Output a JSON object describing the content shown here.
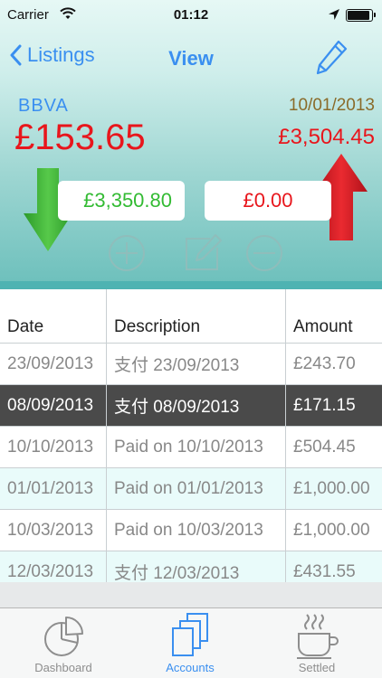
{
  "status_bar": {
    "carrier": "Carrier",
    "time": "01:12"
  },
  "nav": {
    "back_label": "Listings",
    "title": "View"
  },
  "account": {
    "name": "BBVA",
    "balance": "£153.65",
    "date": "10/01/2013",
    "total": "£3,504.45",
    "money_in": "£3,350.80",
    "money_out": "£0.00"
  },
  "table": {
    "headers": [
      "Date",
      "Description",
      "Amount"
    ],
    "rows": [
      {
        "date": "23/09/2013",
        "desc": "支付 23/09/2013",
        "amount": "£243.70"
      },
      {
        "date": "08/09/2013",
        "desc": "支付 08/09/2013",
        "amount": "£171.15"
      },
      {
        "date": "10/10/2013",
        "desc": "Paid on 10/10/2013",
        "amount": "£504.45"
      },
      {
        "date": "01/01/2013",
        "desc": "Paid on 01/01/2013",
        "amount": "£1,000.00"
      },
      {
        "date": "10/03/2013",
        "desc": "Paid on 10/03/2013",
        "amount": "£1,000.00"
      },
      {
        "date": "12/03/2013",
        "desc": "支付 12/03/2013",
        "amount": "£431.55"
      }
    ]
  },
  "tabs": [
    {
      "label": "Dashboard",
      "icon": "pie-chart-icon"
    },
    {
      "label": "Accounts",
      "icon": "documents-icon"
    },
    {
      "label": "Settled",
      "icon": "coffee-cup-icon"
    }
  ],
  "colors": {
    "accent": "#3a8ff0",
    "negative": "#e8161c",
    "positive": "#33bb33",
    "date": "#8a6b2a",
    "selected_row": "#4a4a4a"
  }
}
